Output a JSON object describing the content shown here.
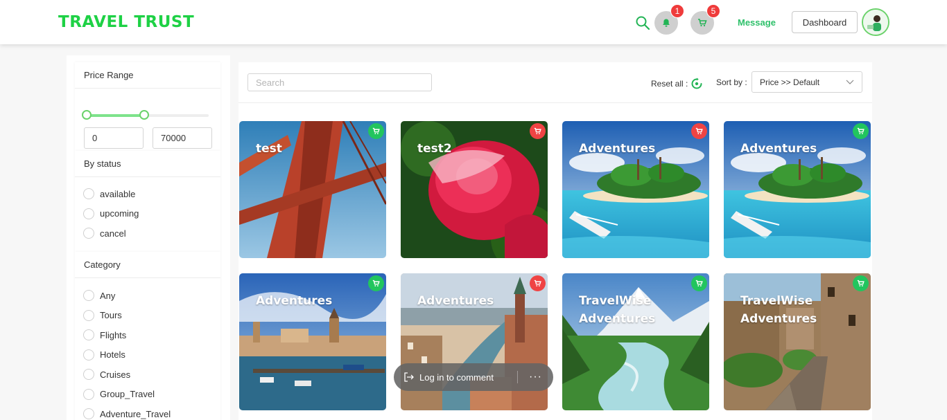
{
  "header": {
    "logo": "TRAVEL TRUST",
    "notifications_count": "1",
    "cart_count": "5",
    "message_label": "Message",
    "dashboard_label": "Dashboard"
  },
  "filters": {
    "price": {
      "title": "Price Range",
      "min_value": "0",
      "max_value": "70000",
      "slider_low_fraction": 0.0,
      "slider_high_fraction": 0.47
    },
    "status": {
      "title": "By status",
      "options": [
        "available",
        "upcoming",
        "cancel"
      ]
    },
    "category": {
      "title": "Category",
      "options": [
        "Any",
        "Tours",
        "Flights",
        "Hotels",
        "Cruises",
        "Group_Travel",
        "Adventure_Travel"
      ]
    }
  },
  "toolbar": {
    "search_placeholder": "Search",
    "reset_label": "Reset all :",
    "sort_label": "Sort by :",
    "sort_value": "Price >> Default"
  },
  "cards": [
    {
      "title": "test",
      "image": "golden-gate-bridge",
      "cart_color": "#22c55e"
    },
    {
      "title": "test2",
      "image": "red-rose",
      "cart_color": "#ef4444"
    },
    {
      "title": "Adventures",
      "image": "tropical-island",
      "cart_color": "#ef4444"
    },
    {
      "title": "Adventures",
      "image": "tropical-island",
      "cart_color": "#22c55e"
    },
    {
      "title": "Adventures",
      "image": "city-harbor",
      "cart_color": "#22c55e"
    },
    {
      "title": "Adventures",
      "image": "old-town-river",
      "cart_color": "#ef4444"
    },
    {
      "title": "TravelWise Adventures",
      "image": "mountain-river",
      "cart_color": "#22c55e"
    },
    {
      "title": "TravelWise Adventures",
      "image": "stone-village-street",
      "cart_color": "#22c55e"
    }
  ],
  "comment_bar": {
    "label": "Log in to comment",
    "more": "···"
  },
  "colors": {
    "brand": "#1ed145",
    "accent": "#2ec06a",
    "badge": "#ef3b3b"
  }
}
